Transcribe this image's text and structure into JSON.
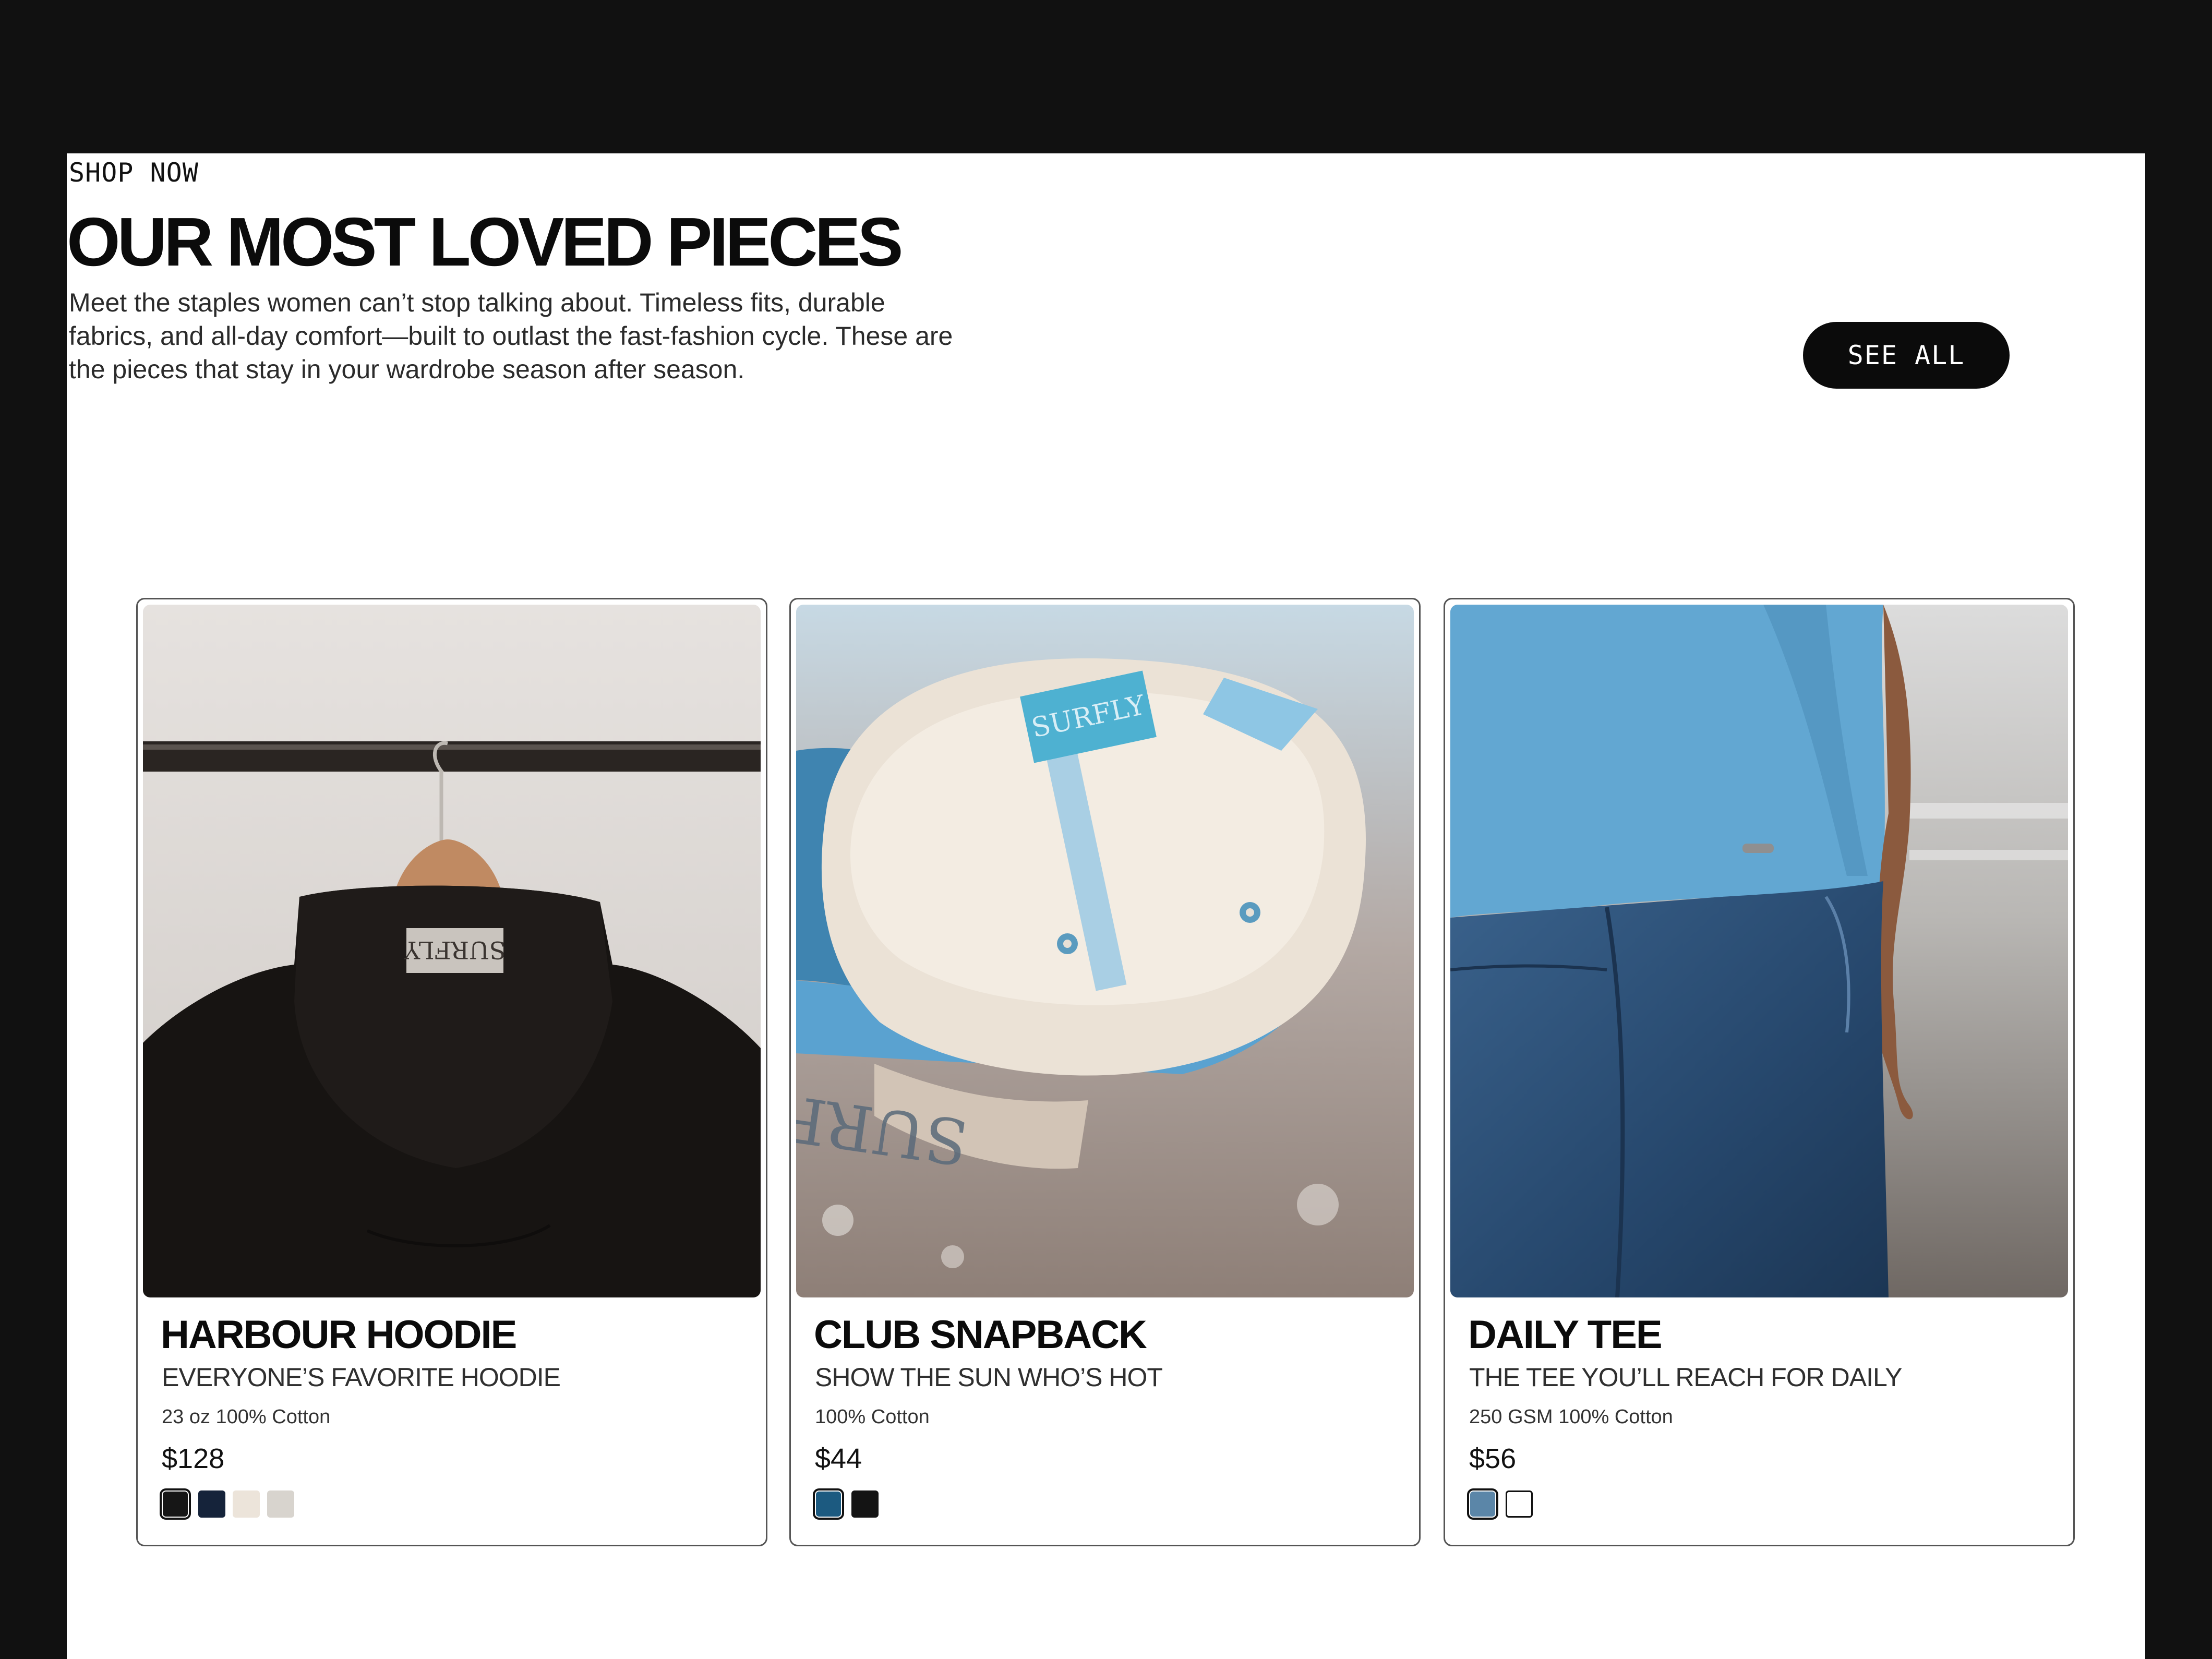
{
  "section": {
    "eyebrow": "SHOP NOW",
    "title": "OUR MOST LOVED PIECES",
    "description": "Meet the staples women can’t stop talking about. Timeless fits, durable fabrics, and all-day comfort—built to outlast the fast-fashion cycle. These are the pieces that stay in your wardrobe season after season.",
    "see_all_label": "SEE ALL"
  },
  "products": [
    {
      "name": "HARBOUR HOODIE",
      "tagline": "EVERYONE’S FAVORITE HOODIE",
      "material": "23 oz 100% Cotton",
      "price": "$128",
      "swatches": [
        "#161616",
        "#15233a",
        "#ece4da",
        "#d8d4ce"
      ],
      "selected_swatch": 0
    },
    {
      "name": "CLUB SNAPBACK",
      "tagline": "SHOW THE SUN WHO’S HOT",
      "material": "100% Cotton",
      "price": "$44",
      "swatches": [
        "#1c5a80",
        "#141414"
      ],
      "selected_swatch": 0
    },
    {
      "name": "DAILY TEE",
      "tagline": "THE TEE YOU’LL REACH FOR DAILY",
      "material": "250 GSM 100% Cotton",
      "price": "$56",
      "swatches": [
        "#5b86a8",
        "#ffffff"
      ],
      "selected_swatch": 0
    }
  ],
  "images": {
    "hoodie_tag": "SURFLY",
    "cap_tag": "SURFLY"
  }
}
